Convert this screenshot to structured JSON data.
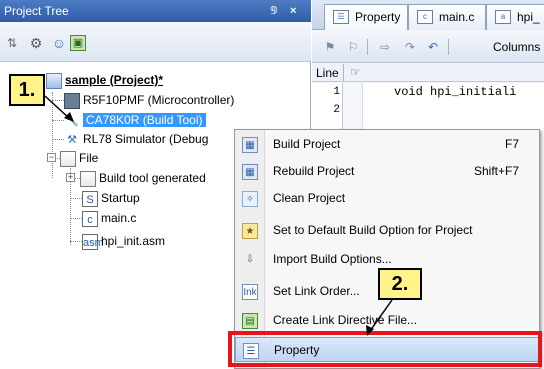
{
  "tree_panel": {
    "title": "Project Tree",
    "pin_glyph": "&#x0032;",
    "close_glyph": "×",
    "toolbar": [
      "sort-icon",
      "gear-icon",
      "user-icon",
      "view-icon"
    ],
    "nodes": {
      "project": "sample (Project)*",
      "microcontroller": "R5F10PMF (Microcontroller)",
      "build_tool": "CA78K0R (Build Tool)",
      "simulator": "RL78 Simulator (Debug",
      "file_folder": "File",
      "generated": "Build tool generated",
      "startup": "Startup",
      "main_c": "main.c",
      "hpi_init": "hpi_init.asm"
    }
  },
  "editor": {
    "tabs": [
      "Property",
      "main.c",
      "hpi_"
    ],
    "toolbar_columns_label": "Columns",
    "line_header": "Line",
    "line_numbers": [
      "1",
      "2"
    ],
    "code_lines": [
      "void hpi_initiali"
    ]
  },
  "context_menu": {
    "items": [
      {
        "label": "Build Project",
        "shortcut": "F7",
        "icon": "build-icon"
      },
      {
        "label": "Rebuild Project",
        "shortcut": "Shift+F7",
        "icon": "rebuild-icon"
      },
      {
        "label": "Clean Project",
        "shortcut": "",
        "icon": "clean-icon"
      },
      {
        "label": "Set to Default Build Option for Project",
        "shortcut": "",
        "icon": "default-option-icon"
      },
      {
        "label": "Import Build Options...",
        "shortcut": "",
        "icon": "import-icon"
      },
      {
        "label": "Set Link Order...",
        "shortcut": "",
        "icon": "link-order-icon"
      },
      {
        "label": "Create Link Directive File...",
        "shortcut": "",
        "icon": "link-directive-icon"
      },
      {
        "label": "Property",
        "shortcut": "",
        "icon": "property-icon"
      }
    ]
  },
  "callouts": {
    "step1": "1.",
    "step2": "2."
  },
  "colors": {
    "highlight_red": "#e8141a",
    "callout_yellow": "#fff38a",
    "selection_blue": "#3399ff"
  }
}
